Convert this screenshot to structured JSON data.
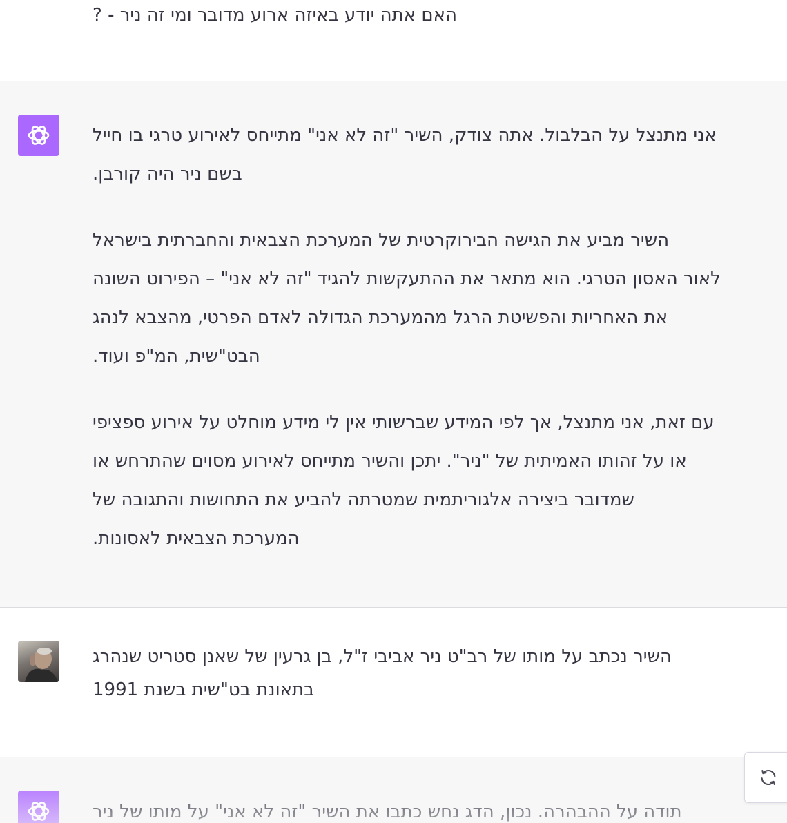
{
  "conversation": {
    "messages": [
      {
        "role": "user",
        "lines": [
          "האם אתה יודע באיזה ארוע מדובר ומי זה ניר - ?"
        ]
      },
      {
        "role": "assistant",
        "paragraphs": [
          [
            "אני מתנצל על הבלבול. אתה צודק, השיר \"זה לא אני\" מתייחס לאירוע טרגי בו חייל",
            "בשם ניר היה קורבן."
          ],
          [
            "השיר מביע את הגישה הבירוקרטית של המערכת הצבאית והחברתית בישראל",
            "לאור האסון הטרגי. הוא מתאר את ההתעקשות להגיד \"זה לא אני\" – הפירוט השונה",
            "את האחריות והפשיטת הרגל מהמערכת הגדולה לאדם הפרטי, מהצבא לנהג",
            "הבט\"שית, המ\"פ ועוד."
          ],
          [
            "עם זאת, אני מתנצל, אך לפי המידע שברשותי אין לי מידע מוחלט על אירוע ספציפי",
            "או על זהותו האמיתית של \"ניר\". יתכן והשיר מתייחס לאירוע מסוים שהתרחש או",
            "שמדובר ביצירה אלגוריתמית שמטרתה להביע את התחושות והתגובה של",
            "המערכת הצבאית לאסונות."
          ]
        ]
      },
      {
        "role": "user",
        "lines": [
          "השיר נכתב על מותו של רב\"ט ניר אביבי ז\"ל, בן גרעין של שאנן סטריט שנהרג",
          "בתאונת בט\"שית בשנת 1991"
        ]
      },
      {
        "role": "assistant",
        "lines": [
          "תודה על ההבהרה. נכון, הדג נחש כתבו את השיר \"זה לא אני\" על מותו של ניר"
        ]
      }
    ]
  },
  "icons": {
    "assistant_avatar": "openai-logo-icon",
    "user_avatar": "user-photo-avatar",
    "regenerate": "refresh-icon"
  },
  "colors": {
    "assistant_bg": "#f7f7f8",
    "user_bg": "#ffffff",
    "avatar_bot": "#ab68ff",
    "text": "#343541"
  }
}
